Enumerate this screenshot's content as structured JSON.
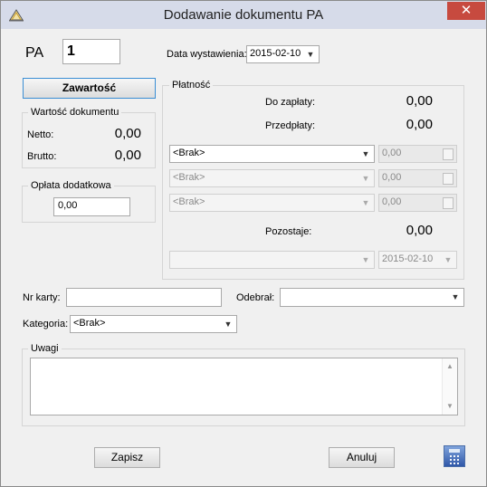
{
  "window": {
    "title": "Dodawanie dokumentu PA",
    "close_glyph": "✕",
    "app_icon": "app-icon"
  },
  "header": {
    "doc_type": "PA",
    "doc_number": "1",
    "issue_date_label": "Data wystawienia:",
    "issue_date": "2015-02-10"
  },
  "left": {
    "contents_button": "Zawartość",
    "value_group": {
      "title": "Wartość dokumentu",
      "net_label": "Netto:",
      "net_value": "0,00",
      "gross_label": "Brutto:",
      "gross_value": "0,00"
    },
    "surcharge_group": {
      "title": "Opłata dodatkowa",
      "value": "0,00"
    }
  },
  "payment": {
    "title": "Płatność",
    "due_label": "Do zapłaty:",
    "due_value": "0,00",
    "prepaid_label": "Przedpłaty:",
    "prepaid_value": "0,00",
    "rows": [
      {
        "method": "<Brak>",
        "amount": "0,00",
        "enabled": true
      },
      {
        "method": "<Brak>",
        "amount": "0,00",
        "enabled": false
      },
      {
        "method": "<Brak>",
        "amount": "0,00",
        "enabled": false
      }
    ],
    "remaining_label": "Pozostaje:",
    "remaining_value": "0,00",
    "deferred_method": "",
    "deferred_date": "2015-02-10"
  },
  "details": {
    "card_label": "Nr karty:",
    "card_value": "",
    "received_label": "Odebrał:",
    "received_value": "",
    "category_label": "Kategoria:",
    "category_value": "<Brak>",
    "notes_title": "Uwagi",
    "notes_value": ""
  },
  "footer": {
    "save_button": "Zapisz",
    "cancel_button": "Anuluj",
    "calculator_icon": "calculator-icon"
  }
}
